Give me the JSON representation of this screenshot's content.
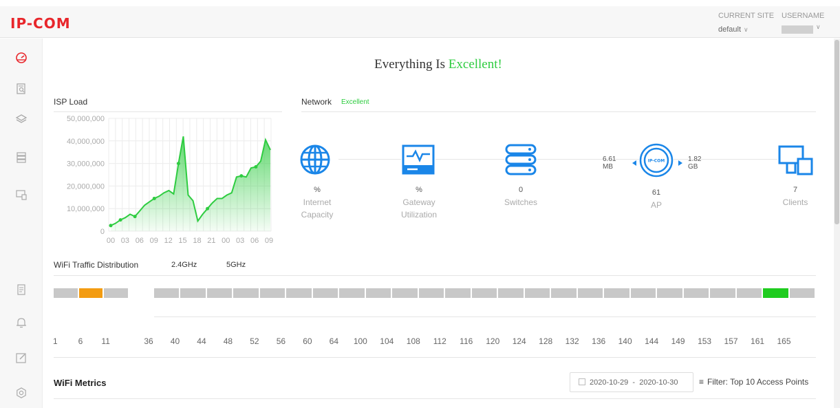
{
  "header": {
    "logo": "IP-COM",
    "current_site_label": "CURRENT SITE",
    "current_site_value": "default",
    "username_label": "USERNAME"
  },
  "sidebar": {
    "items": [
      {
        "icon": "dashboard-icon"
      },
      {
        "icon": "report-search-icon"
      },
      {
        "icon": "layers-icon"
      },
      {
        "icon": "server-stack-icon"
      },
      {
        "icon": "devices-icon"
      },
      {
        "icon": "document-icon"
      },
      {
        "icon": "bell-icon"
      },
      {
        "icon": "edit-icon"
      },
      {
        "icon": "settings-icon"
      }
    ]
  },
  "status": {
    "prefix": "Everything Is ",
    "state": "Excellent!",
    "state_color": "#2ecc40"
  },
  "isp_load": {
    "title": "ISP Load",
    "chart_data": {
      "type": "area",
      "title": "ISP Load",
      "y_ticks": [
        "50,000,000",
        "40,000,000",
        "30,000,000",
        "20,000,000",
        "10,000,000",
        "0"
      ],
      "ylim": [
        0,
        50000000
      ],
      "x_ticks": [
        "00",
        "03",
        "06",
        "09",
        "12",
        "15",
        "18",
        "21",
        "00",
        "03",
        "06",
        "09"
      ],
      "series": [
        {
          "color": "#2ecc40",
          "values": [
            2500000,
            3500000,
            5000000,
            6000000,
            7500000,
            6500000,
            9000000,
            11500000,
            13000000,
            14500000,
            15500000,
            17000000,
            18000000,
            16500000,
            30000000,
            42000000,
            16000000,
            13500000,
            4500000,
            7500000,
            10000000,
            12500000,
            14500000,
            14500000,
            16000000,
            17000000,
            24000000,
            24500000,
            24000000,
            28000000,
            28500000,
            31000000,
            40500000,
            36000000
          ]
        }
      ]
    }
  },
  "network": {
    "title": "Network",
    "status": "Excellent",
    "items": [
      {
        "value": "%",
        "label_1": "Internet",
        "label_2": "Capacity"
      },
      {
        "value": "%",
        "label_1": "Gateway",
        "label_2": "Utilization"
      },
      {
        "value": "0",
        "label_1": "Switches",
        "label_2": ""
      },
      {
        "value": "61",
        "label_1": "AP",
        "label_2": ""
      },
      {
        "value": "7",
        "label_1": "Clients",
        "label_2": ""
      }
    ],
    "ap_download": {
      "value": "6.61",
      "unit": "MB"
    },
    "ap_upload": {
      "value": "1.82",
      "unit": "GB"
    }
  },
  "wifi_traffic": {
    "title": "WiFi Traffic Distribution",
    "tab_24": "2.4GHz",
    "tab_5": "5GHz",
    "channels_24": [
      "1",
      "6",
      "11"
    ],
    "channels_5": [
      "36",
      "40",
      "44",
      "48",
      "52",
      "56",
      "60",
      "64",
      "100",
      "104",
      "108",
      "112",
      "116",
      "120",
      "124",
      "128",
      "132",
      "136",
      "140",
      "144",
      "149",
      "153",
      "157",
      "161",
      "165"
    ],
    "active_24": "6",
    "active_5": "161",
    "active_24_color": "#f39c12",
    "active_5_color": "#1fcc1f",
    "idle_color": "#c8c8c8"
  },
  "wifi_metrics": {
    "title": "WiFi Metrics",
    "date_start": "2020-10-29",
    "date_sep": "-",
    "date_end": "2020-10-30",
    "filter_label": "Filter: Top 10 Access Points"
  }
}
